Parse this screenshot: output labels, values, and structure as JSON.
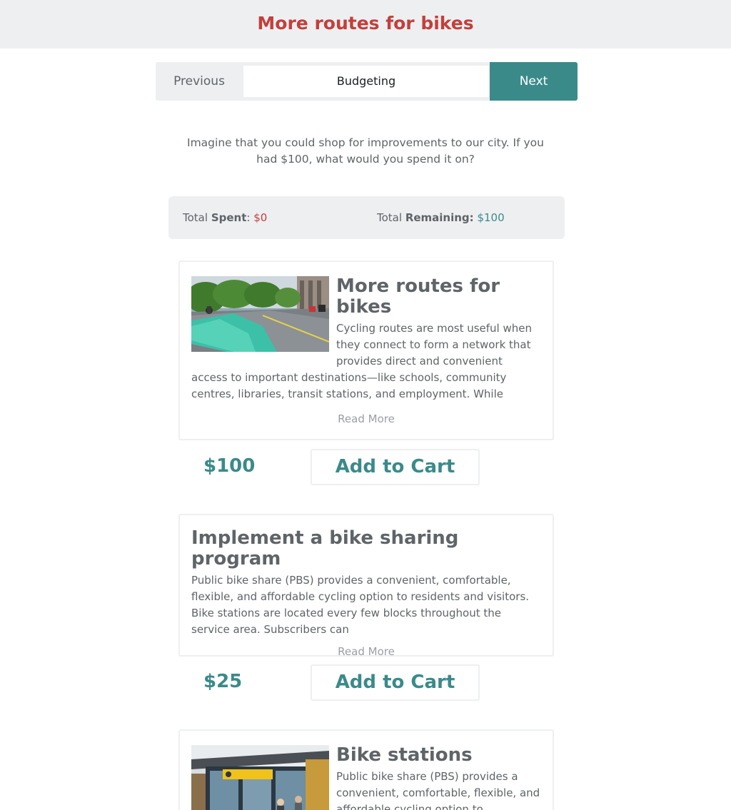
{
  "header": {
    "title": "More routes for bikes"
  },
  "stepper": {
    "previous_label": "Previous",
    "current_step": "Budgeting",
    "next_label": "Next"
  },
  "intro": {
    "text": "Imagine that you could shop for improvements to our city. If you had $100, what would you spend it on?"
  },
  "totals": {
    "spent_prefix": "Total ",
    "spent_bold": "Spent",
    "spent_colon": ": ",
    "spent_value": "$0",
    "remaining_prefix": "Total ",
    "remaining_bold": "Remaining:",
    "remaining_value": "$100"
  },
  "items": [
    {
      "title": "More routes for bikes",
      "description": "Cycling routes are most useful when they connect to form a network that provides direct and convenient access to important destinations—like schools, community centres, libraries, transit stations, and employment. While",
      "read_more": "Read More",
      "price": "$100",
      "add_label": "Add to Cart",
      "image": "bike-lane-photo"
    },
    {
      "title": "Implement a bike sharing program",
      "description": "Public bike share (PBS) provides a convenient, comfortable, flexible, and affordable cycling option to residents and visitors. Bike stations are located every few blocks throughout the service area. Subscribers can",
      "read_more": "Read More",
      "price": "$25",
      "add_label": "Add to Cart"
    },
    {
      "title": "Bike stations",
      "description": "Public bike share (PBS) provides a convenient, comfortable, flexible, and affordable cycling option to",
      "image": "bike-station-photo"
    }
  ],
  "colors": {
    "accent": "#3b8a8a",
    "brand_red": "#c33f3b",
    "panel_gray": "#eeeff1",
    "text": "#5f6468"
  }
}
